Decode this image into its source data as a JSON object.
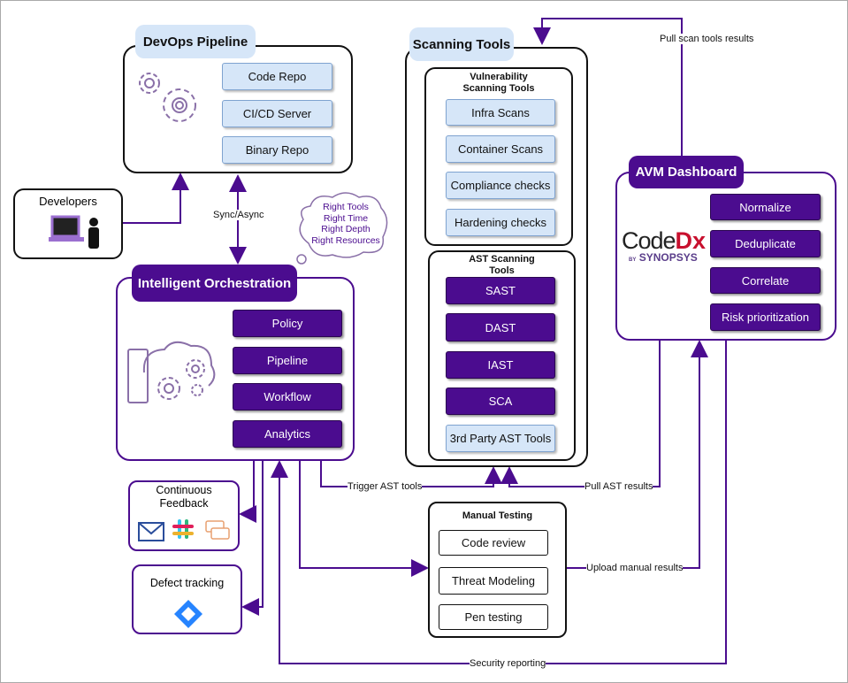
{
  "colors": {
    "accent": "#4b0c8f",
    "light_blue": "#d6e6f8"
  },
  "devops": {
    "title": "DevOps Pipeline",
    "items": [
      "Code Repo",
      "CI/CD Server",
      "Binary Repo"
    ],
    "icon": "gears-icon"
  },
  "developers": {
    "title": "Developers",
    "icon": "developer-laptop-icon"
  },
  "sync_label": "Sync/Async",
  "cloud": {
    "lines": [
      "Right Tools",
      "Right Time",
      "Right Depth",
      "Right Resources"
    ]
  },
  "orchestration": {
    "title": "Intelligent Orchestration",
    "items": [
      "Policy",
      "Pipeline",
      "Workflow",
      "Analytics"
    ],
    "icon": "cloud-gears-icon"
  },
  "feedback": {
    "title_line1": "Continuous",
    "title_line2": "Feedback",
    "icons": [
      "email-icon",
      "slack-icon",
      "chat-icon"
    ]
  },
  "defect": {
    "title": "Defect tracking",
    "icon": "jira-icon"
  },
  "scanning": {
    "title": "Scanning Tools",
    "vuln": {
      "title_line1": "Vulnerability",
      "title_line2": "Scanning Tools",
      "items": [
        "Infra Scans",
        "Container Scans",
        "Compliance checks",
        "Hardening checks"
      ]
    },
    "ast": {
      "title_line1": "AST Scanning",
      "title_line2": "Tools",
      "items": [
        "SAST",
        "DAST",
        "IAST",
        "SCA"
      ],
      "third_party": "3rd Party AST Tools"
    }
  },
  "avm": {
    "title": "AVM Dashboard",
    "items": [
      "Normalize",
      "Deduplicate",
      "Correlate",
      "Risk prioritization"
    ],
    "logo": {
      "code": "Code",
      "dx": "Dx",
      "by": "BY",
      "synopsys": "SYNOPSYS"
    }
  },
  "manual": {
    "title": "Manual Testing",
    "items": [
      "Code review",
      "Threat Modeling",
      "Pen testing"
    ]
  },
  "edges": {
    "pull_scan": "Pull scan tools results",
    "trigger_ast": "Trigger AST tools",
    "pull_ast": "Pull AST results",
    "upload_manual": "Upload manual results",
    "security_reporting": "Security reporting"
  }
}
